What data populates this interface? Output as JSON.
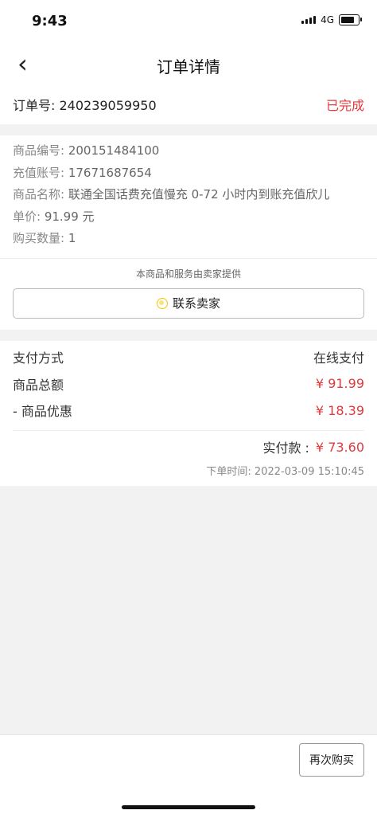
{
  "status_bar": {
    "time": "9:43",
    "network": "4G"
  },
  "nav": {
    "back_icon": "‹",
    "title": "订单详情"
  },
  "order": {
    "number_label": "订单号: 240239059950",
    "status": "已完成"
  },
  "goods": [
    {
      "label": "商品编号: ",
      "value": "200151484100"
    },
    {
      "label": "充值账号: ",
      "value": "17671687654"
    },
    {
      "label": "商品名称: ",
      "value": "联通全国话费充值慢充 0-72 小时内到账充值欣儿"
    },
    {
      "label": "单价: ",
      "value": "91.99 元"
    },
    {
      "label": "购买数量: ",
      "value": "1"
    }
  ],
  "seller": {
    "note": "本商品和服务由卖家提供",
    "contact_label": "联系卖家"
  },
  "payment": {
    "method_label": "支付方式",
    "method_value": "在线支付",
    "total_label": "商品总额",
    "total_value": "¥ 91.99",
    "discount_label": "- 商品优惠",
    "discount_value": "¥ 18.39",
    "paid_label": "实付款 :",
    "paid_value": "¥ 73.60",
    "order_time": "下单时间: 2022-03-09 15:10:45"
  },
  "actions": {
    "rebuy_label": "再次购买"
  },
  "colors": {
    "accent_red": "#e4393c",
    "bg_gray": "#f2f2f2"
  }
}
